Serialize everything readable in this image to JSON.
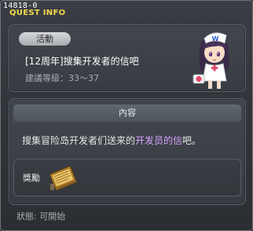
{
  "header": {
    "quest_id": "14818-0",
    "title": "QUEST INFO"
  },
  "quest": {
    "badge": "活動",
    "name": "[12周年]搜集开发者的信吧",
    "level_text": "建議等級：33～37",
    "npc_icon": "nurse-npc-portrait"
  },
  "content": {
    "header": "內容",
    "text_before": "搜集冒险岛开发者们送来的",
    "text_highlight": "开发员的信",
    "text_after": "吧。",
    "highlight_color": "#d9a3ff"
  },
  "reward": {
    "label": "獎勵",
    "icon": "letter-book-icon"
  },
  "status": {
    "text": "狀態:  可開始"
  }
}
